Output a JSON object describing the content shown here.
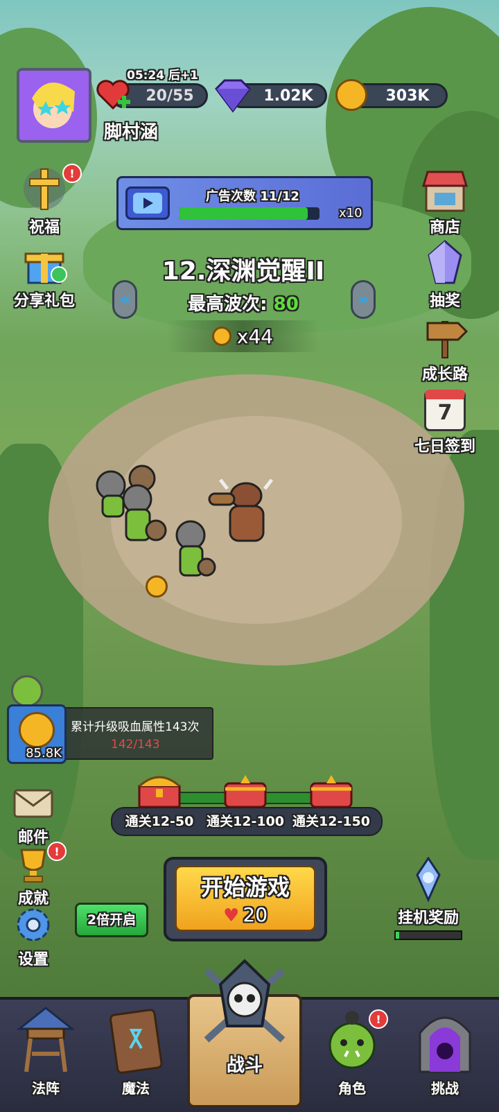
{
  "status": {
    "timer": "05:24",
    "timer_suffix": "后+1",
    "energy": "20/55",
    "gems": "1.02K",
    "coins": "303K",
    "player_name": "脚村涵"
  },
  "ad_panel": {
    "label": "广告次数 11/12",
    "multiplier": "x10",
    "progress": 0.917
  },
  "stage": {
    "title": "12.深渊觉醒II",
    "best_wave_label": "最高波次:",
    "best_wave_value": "80",
    "coin_reward": "x44"
  },
  "left_menu": {
    "bless": "祝福",
    "share_gift": "分享礼包",
    "mail": "邮件",
    "achievement": "成就",
    "settings": "设置"
  },
  "right_menu": {
    "shop": "商店",
    "lottery": "抽奖",
    "growth_path": "成长路",
    "seven_day": "七日签到",
    "seven_day_num": "7",
    "idle_reward": "挂机奖励"
  },
  "quest": {
    "amount": "85.8K",
    "text": "累计升级吸血属性143次",
    "progress": "142/143"
  },
  "chests": [
    "通关12-50",
    "通关12-100",
    "通关12-150"
  ],
  "speed_button": "2倍开启",
  "start_button": {
    "label": "开始游戏",
    "cost": "20"
  },
  "bottom_nav": {
    "formation": "法阵",
    "magic": "魔法",
    "battle": "战斗",
    "character": "角色",
    "challenge": "挑战"
  },
  "colors": {
    "accent_green": "#4ccb3a",
    "gold": "#f5b626",
    "badge_red": "#e43b3b"
  }
}
